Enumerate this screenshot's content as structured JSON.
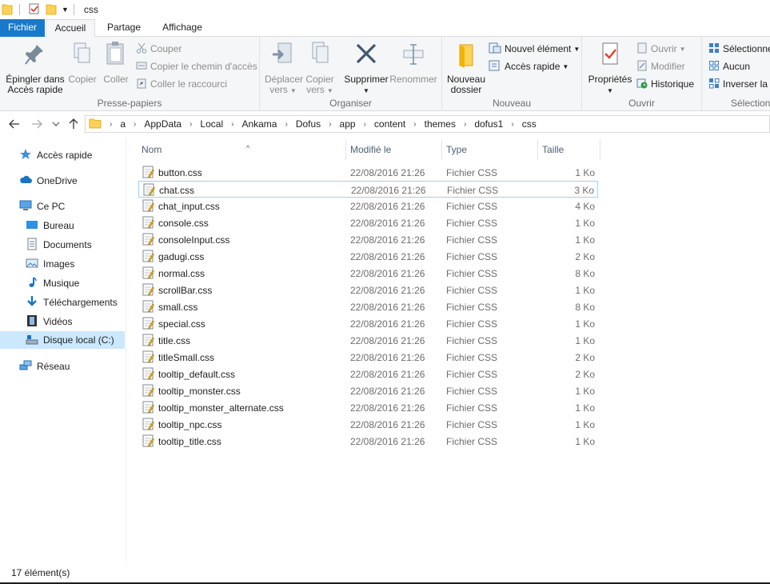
{
  "window": {
    "title": "css"
  },
  "tabs": [
    {
      "label": "Fichier"
    },
    {
      "label": "Accueil"
    },
    {
      "label": "Partage"
    },
    {
      "label": "Affichage"
    }
  ],
  "ribbon": {
    "clipboard": {
      "pin_label_1": "Épingler dans",
      "pin_label_2": "Accès rapide",
      "copy_label": "Copier",
      "paste_label": "Coller",
      "cut_label": "Couper",
      "copy_path_label": "Copier le chemin d'accès",
      "paste_shortcut_label": "Coller le raccourci",
      "group_label": "Presse-papiers"
    },
    "organize": {
      "move_label_1": "Déplacer",
      "move_label_2": "vers",
      "copy_to_label_1": "Copier",
      "copy_to_label_2": "vers",
      "delete_label": "Supprimer",
      "rename_label": "Renommer",
      "group_label": "Organiser"
    },
    "new": {
      "new_folder_label_1": "Nouveau",
      "new_folder_label_2": "dossier",
      "new_item_label": "Nouvel élément",
      "easy_access_label": "Accès rapide",
      "group_label": "Nouveau"
    },
    "open": {
      "properties_label": "Propriétés",
      "open_label": "Ouvrir",
      "edit_label": "Modifier",
      "history_label": "Historique",
      "group_label": "Ouvrir"
    },
    "select": {
      "select_all_label": "Sélectionner",
      "select_none_label": "Aucun",
      "invert_label": "Inverser la s",
      "group_label": "Sélection"
    }
  },
  "address": {
    "crumbs": [
      "a",
      "AppData",
      "Local",
      "Ankama",
      "Dofus",
      "app",
      "content",
      "themes",
      "dofus1",
      "css"
    ]
  },
  "navpane": {
    "quick_access": "Accès rapide",
    "onedrive": "OneDrive",
    "this_pc": "Ce PC",
    "desktop": "Bureau",
    "documents": "Documents",
    "pictures": "Images",
    "music": "Musique",
    "downloads": "Téléchargements",
    "videos": "Vidéos",
    "local_disk": "Disque local (C:)",
    "network": "Réseau"
  },
  "columns": {
    "name": "Nom",
    "modified": "Modifié le",
    "type": "Type",
    "size": "Taille"
  },
  "files": [
    {
      "name": "button.css",
      "date": "22/08/2016 21:26",
      "type": "Fichier CSS",
      "size": "1 Ko"
    },
    {
      "name": "chat.css",
      "date": "22/08/2016 21:26",
      "type": "Fichier CSS",
      "size": "3 Ko"
    },
    {
      "name": "chat_input.css",
      "date": "22/08/2016 21:26",
      "type": "Fichier CSS",
      "size": "4 Ko"
    },
    {
      "name": "console.css",
      "date": "22/08/2016 21:26",
      "type": "Fichier CSS",
      "size": "1 Ko"
    },
    {
      "name": "consoleInput.css",
      "date": "22/08/2016 21:26",
      "type": "Fichier CSS",
      "size": "1 Ko"
    },
    {
      "name": "gadugi.css",
      "date": "22/08/2016 21:26",
      "type": "Fichier CSS",
      "size": "2 Ko"
    },
    {
      "name": "normal.css",
      "date": "22/08/2016 21:26",
      "type": "Fichier CSS",
      "size": "8 Ko"
    },
    {
      "name": "scrollBar.css",
      "date": "22/08/2016 21:26",
      "type": "Fichier CSS",
      "size": "1 Ko"
    },
    {
      "name": "small.css",
      "date": "22/08/2016 21:26",
      "type": "Fichier CSS",
      "size": "8 Ko"
    },
    {
      "name": "special.css",
      "date": "22/08/2016 21:26",
      "type": "Fichier CSS",
      "size": "1 Ko"
    },
    {
      "name": "title.css",
      "date": "22/08/2016 21:26",
      "type": "Fichier CSS",
      "size": "1 Ko"
    },
    {
      "name": "titleSmall.css",
      "date": "22/08/2016 21:26",
      "type": "Fichier CSS",
      "size": "2 Ko"
    },
    {
      "name": "tooltip_default.css",
      "date": "22/08/2016 21:26",
      "type": "Fichier CSS",
      "size": "2 Ko"
    },
    {
      "name": "tooltip_monster.css",
      "date": "22/08/2016 21:26",
      "type": "Fichier CSS",
      "size": "1 Ko"
    },
    {
      "name": "tooltip_monster_alternate.css",
      "date": "22/08/2016 21:26",
      "type": "Fichier CSS",
      "size": "1 Ko"
    },
    {
      "name": "tooltip_npc.css",
      "date": "22/08/2016 21:26",
      "type": "Fichier CSS",
      "size": "1 Ko"
    },
    {
      "name": "tooltip_title.css",
      "date": "22/08/2016 21:26",
      "type": "Fichier CSS",
      "size": "1 Ko"
    }
  ],
  "status": {
    "count_text": "17 élément(s)"
  },
  "colors": {
    "accent": "#1979ca",
    "selection": "#cce8ff",
    "folder": "#ffd15c"
  }
}
